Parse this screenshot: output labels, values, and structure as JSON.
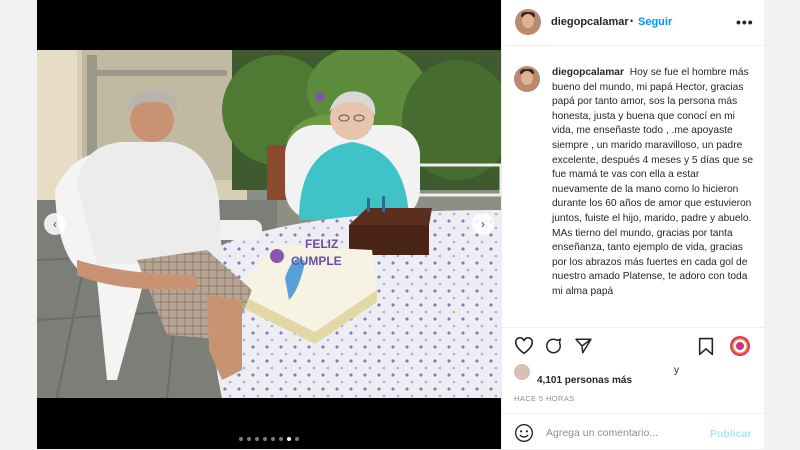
{
  "post": {
    "username": "diegopcalamar",
    "follow_label": "Seguir",
    "more_label": "•••",
    "caption": "Hoy se fue el hombre más bueno del mundo, mi papá Hector, gracias papá por tanto amor, sos la persona más honesta, justa y buena que conocí en mi vida, me enseñaste todo , .me apoyaste siempre , un marido maravilloso, un padre excelente, después 4 meses y 5 días que se fue mamá te vas con ella a estar nuevamente de la mano como lo hicieron durante los 60 años de amor que estuvieron juntos, fuiste el hijo, marido, padre y abuelo. MAs tierno del mundo, gracias por tanta enseñanza, tanto ejemplo de vida, gracias por los abrazos más fuertes en cada gol de nuestro amado Platense, te adoro con toda mi alma papá",
    "likes_partial": "y",
    "likes_text": "4,101 personas más",
    "timestamp": "HACE 5 HORAS",
    "comment_placeholder": "Agrega un comentario...",
    "publish_label": "Publicar"
  },
  "carousel": {
    "prev_icon": "chevron-left-icon",
    "next_icon": "chevron-right-icon",
    "slide_count": 8,
    "active_slide": 7,
    "cake_text": "FELIZ",
    "cake_text_2": "CUMPLE"
  },
  "colors": {
    "accent": "#0095f6",
    "publish_disabled": "#b2dffc",
    "muted": "#8e8e8e"
  }
}
